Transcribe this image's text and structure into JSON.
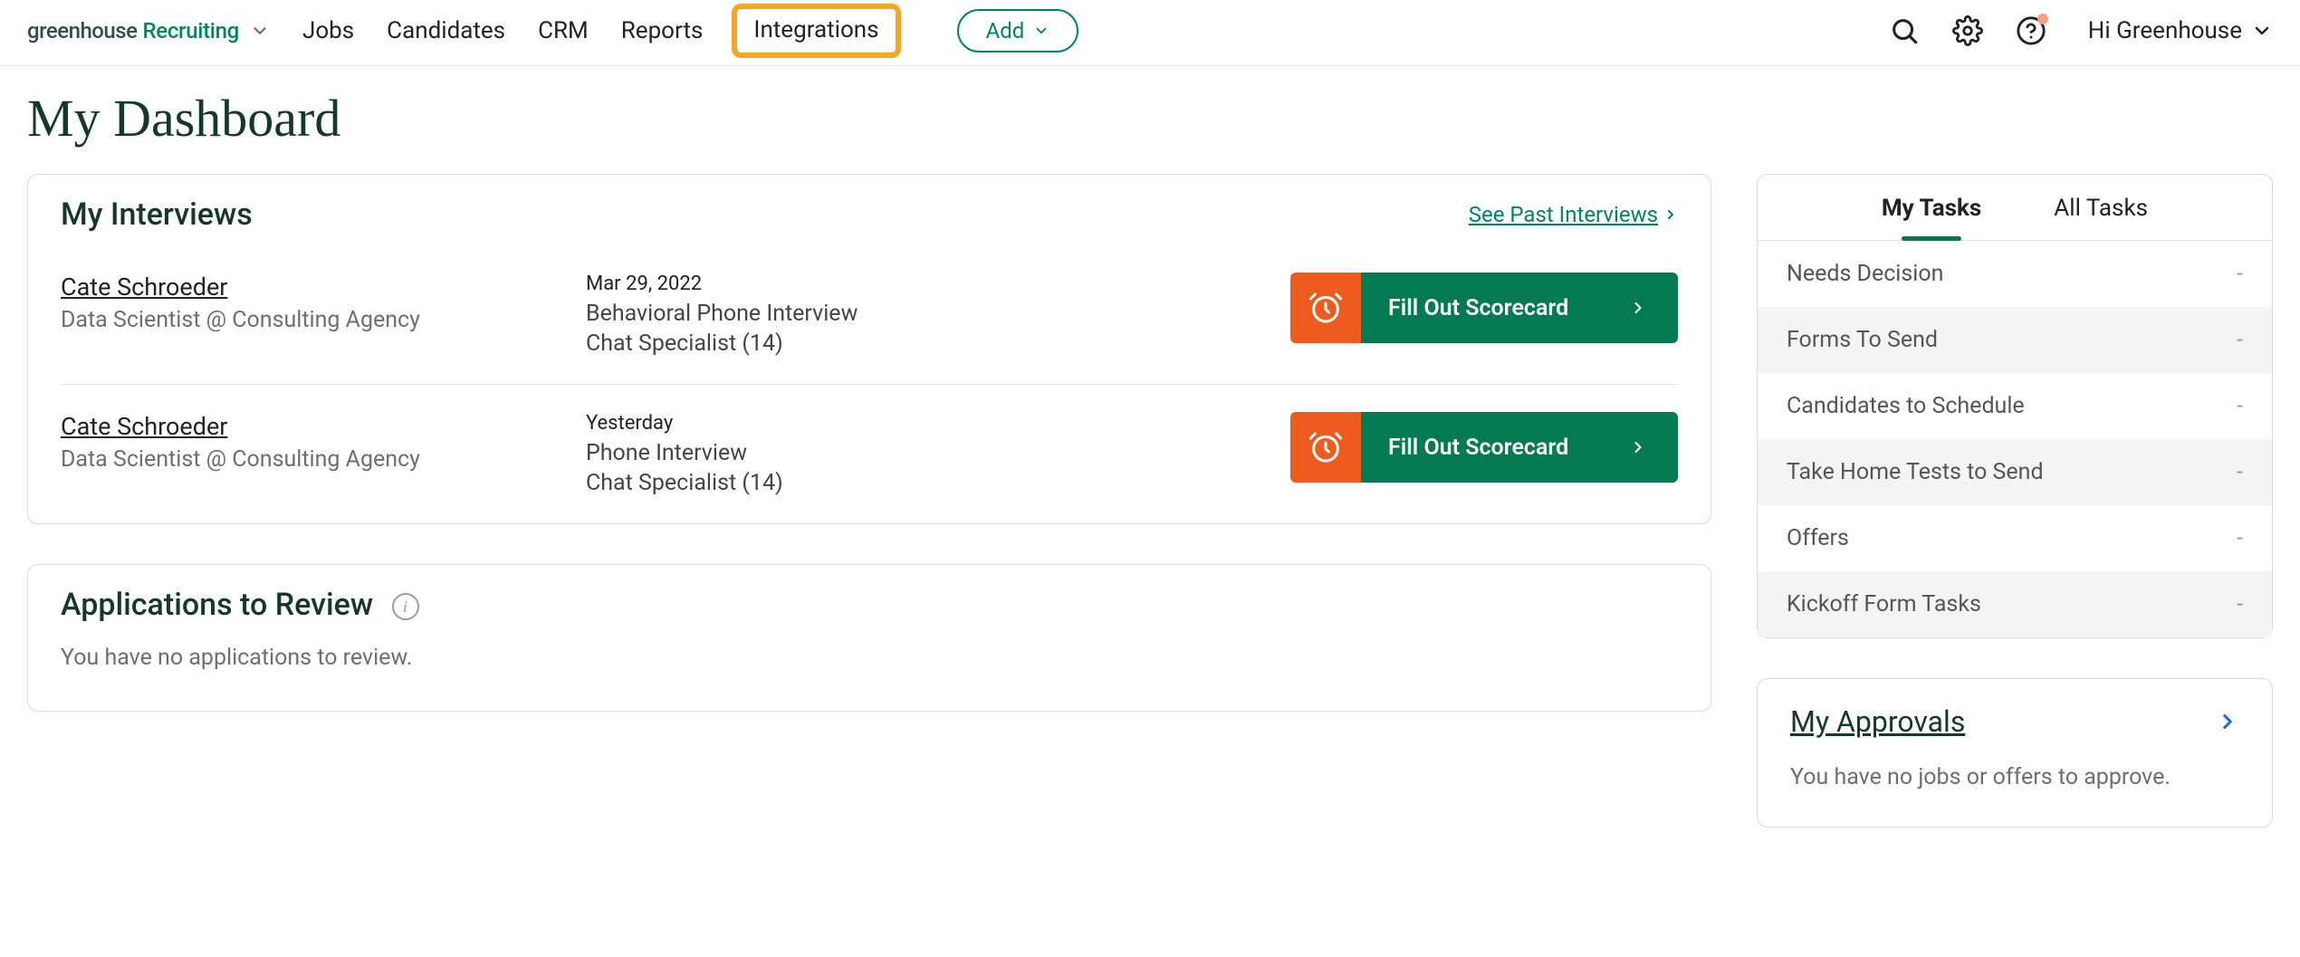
{
  "brand": {
    "part1": "greenhouse",
    "part2": "Recruiting"
  },
  "nav": {
    "items": [
      "Jobs",
      "Candidates",
      "CRM",
      "Reports",
      "Integrations"
    ],
    "highlighted_index": 4,
    "add_label": "Add"
  },
  "user": {
    "greeting": "Hi Greenhouse"
  },
  "page_title": "My Dashboard",
  "interviews": {
    "title": "My Interviews",
    "past_link": "See Past Interviews",
    "action_label": "Fill Out Scorecard",
    "rows": [
      {
        "name": "Cate Schroeder",
        "role": "Data Scientist @ Consulting Agency",
        "date": "Mar 29, 2022",
        "detail": "Behavioral Phone Interview",
        "detail2": "Chat Specialist (14)"
      },
      {
        "name": "Cate Schroeder",
        "role": "Data Scientist @ Consulting Agency",
        "date": "Yesterday",
        "detail": "Phone Interview",
        "detail2": "Chat Specialist (14)"
      }
    ]
  },
  "applications": {
    "title": "Applications to Review",
    "empty": "You have no applications to review."
  },
  "tasks": {
    "tabs": {
      "mine": "My Tasks",
      "all": "All Tasks"
    },
    "rows": [
      {
        "label": "Needs Decision",
        "count": "-"
      },
      {
        "label": "Forms To Send",
        "count": "-"
      },
      {
        "label": "Candidates to Schedule",
        "count": "-"
      },
      {
        "label": "Take Home Tests to Send",
        "count": "-"
      },
      {
        "label": "Offers",
        "count": "-"
      },
      {
        "label": "Kickoff Form Tasks",
        "count": "-"
      }
    ]
  },
  "approvals": {
    "title": "My Approvals",
    "empty": "You have no jobs or offers to approve."
  }
}
